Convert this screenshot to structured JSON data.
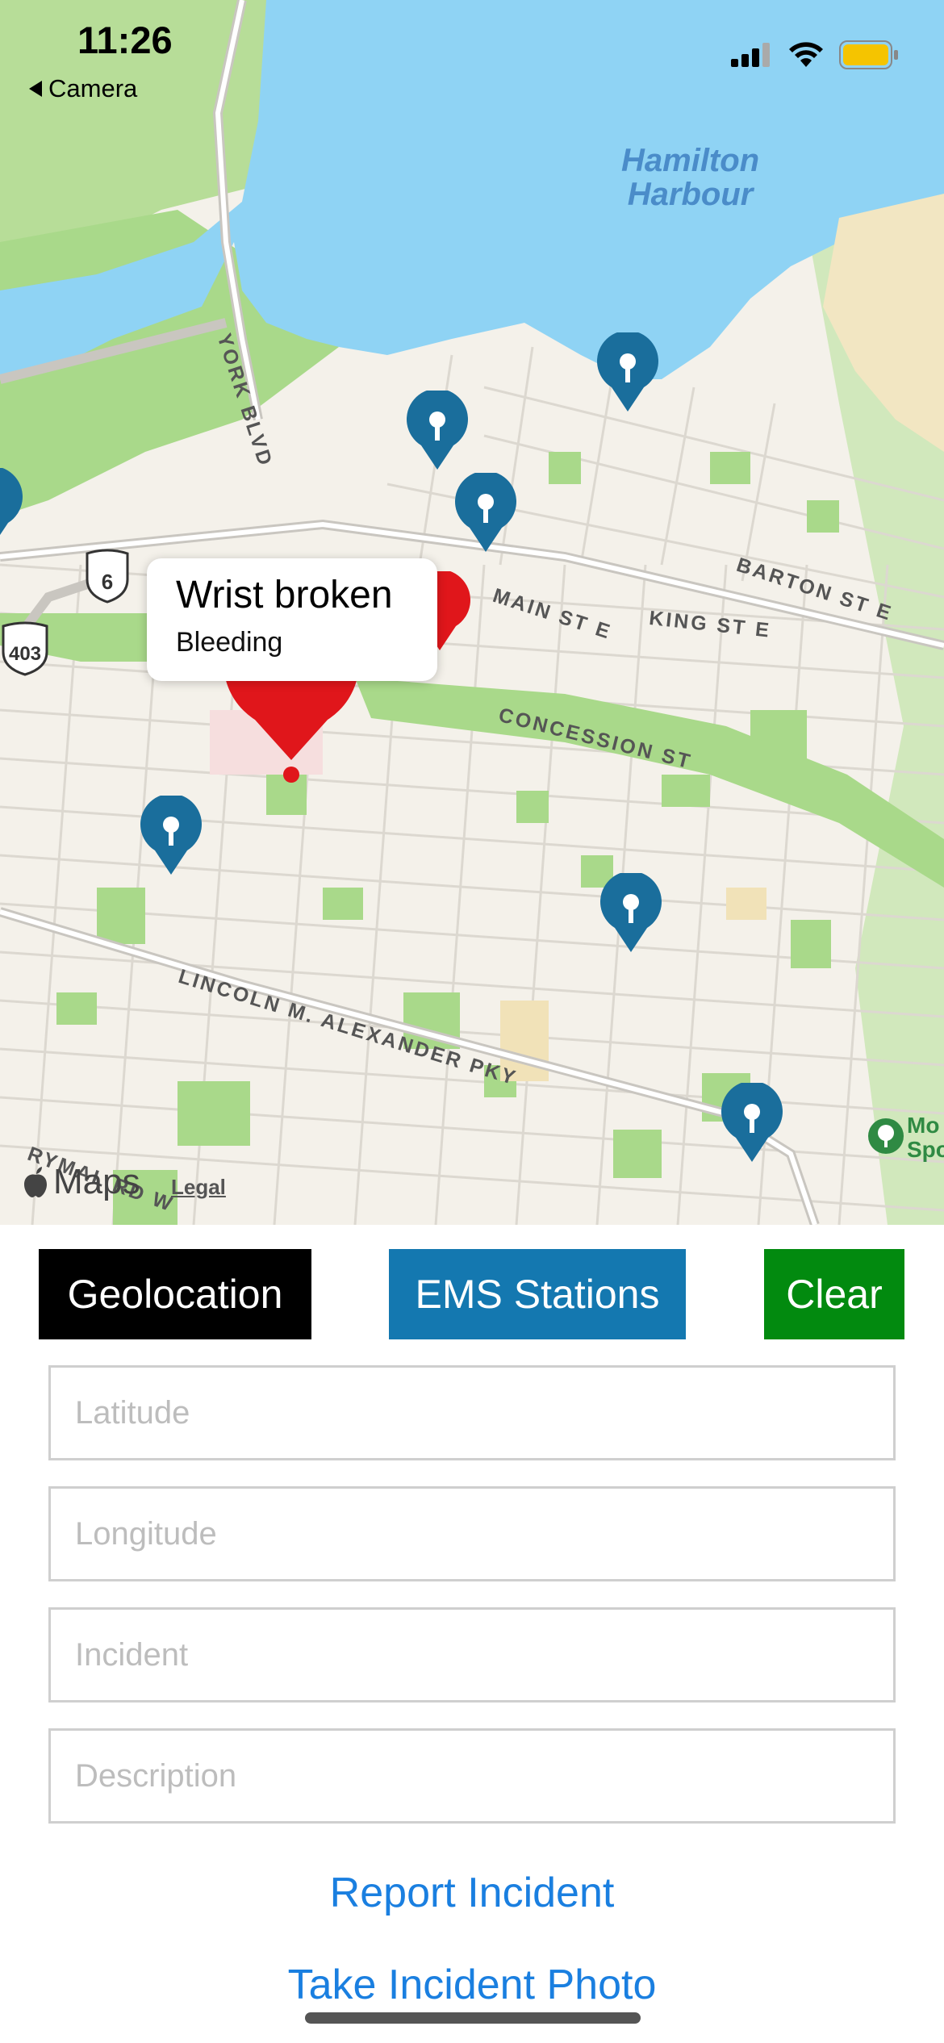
{
  "status_bar": {
    "time": "11:26",
    "back_label": "Camera"
  },
  "map": {
    "water_label_line1": "Hamilton",
    "water_label_line2": "Harbour",
    "street_labels": {
      "york": "YORK BLVD",
      "barton": "BARTON ST E",
      "main": "MAIN ST E",
      "king": "KING ST E",
      "concession": "CONCESSION ST",
      "lincoln": "LINCOLN M. ALEXANDER PKY",
      "rymal": "RYMAL RD W"
    },
    "highway_shields": [
      "6",
      "403"
    ],
    "poi_label_line1": "Mo",
    "poi_label_line2": "Spo",
    "attribution": "Maps",
    "legal": "Legal",
    "callout": {
      "title": "Wrist broken",
      "subtitle": "Bleeding"
    }
  },
  "controls": {
    "geolocation": "Geolocation",
    "ems_stations": "EMS Stations",
    "clear": "Clear"
  },
  "form": {
    "latitude_placeholder": "Latitude",
    "longitude_placeholder": "Longitude",
    "incident_placeholder": "Incident",
    "description_placeholder": "Description"
  },
  "actions": {
    "report": "Report Incident",
    "photo": "Take Incident Photo"
  },
  "colors": {
    "geolocation_bg": "#000000",
    "ems_bg": "#1478b0",
    "clear_bg": "#028a0f",
    "link": "#1a7fe0",
    "ems_pin": "#1a6e9c",
    "incident_pin": "#e0161b",
    "water": "#8fd3f4",
    "park": "#a9d98a"
  }
}
